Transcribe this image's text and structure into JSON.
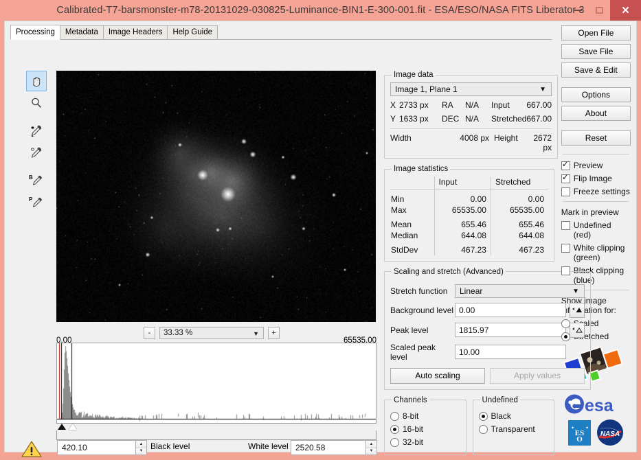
{
  "window": {
    "title": "Calibrated-T7-barsmonster-m78-20131029-030825-Luminance-BIN1-E-300-001.fit - ESA/ESO/NASA FITS Liberator 3",
    "minimize_label": "–",
    "maximize_label": "□",
    "close_label": "✕",
    "titlebar_color": "#f5a394",
    "close_color": "#c75050"
  },
  "tabs": [
    {
      "label": "Processing",
      "active": true
    },
    {
      "label": "Metadata",
      "active": false
    },
    {
      "label": "Image Headers",
      "active": false
    },
    {
      "label": "Help Guide",
      "active": false
    }
  ],
  "tools": [
    {
      "name": "hand-tool",
      "selected": true
    },
    {
      "name": "zoom-tool",
      "selected": false
    },
    {
      "name": "white-picker-tool",
      "selected": false
    },
    {
      "name": "black-picker-tool",
      "selected": false
    },
    {
      "name": "background-picker-tool",
      "selected": false,
      "letter": "B"
    },
    {
      "name": "peak-picker-tool",
      "selected": false,
      "letter": "P"
    }
  ],
  "zoom_bar": {
    "minus_label": "-",
    "plus_label": "+",
    "value": "33.33 %",
    "range_low": "0.00",
    "range_high": "65535.00"
  },
  "levels": {
    "black_value": "420.10",
    "black_label": "Black level",
    "white_label": "White level",
    "white_value": "2520.58",
    "warning_icon": "warning-triangle-icon"
  },
  "image_data": {
    "legend": "Image data",
    "plane_selector": "Image 1, Plane 1",
    "rows": [
      {
        "k": "X",
        "v1": "2733 px",
        "k2": "RA",
        "v2": "N/A",
        "k3": "Input",
        "v3": "667.00"
      },
      {
        "k": "Y",
        "v1": "1633 px",
        "k2": "DEC",
        "v2": "N/A",
        "k3": "Stretched",
        "v3": "667.00"
      }
    ],
    "width_label": "Width",
    "width_value": "4008 px",
    "height_label": "Height",
    "height_value": "2672 px"
  },
  "image_statistics": {
    "legend": "Image statistics",
    "col_input": "Input",
    "col_stretched": "Stretched",
    "rows": [
      {
        "label": "Min",
        "input": "0.00",
        "stretched": "0.00"
      },
      {
        "label": "Max",
        "input": "65535.00",
        "stretched": "65535.00"
      },
      {
        "label": "Mean",
        "input": "655.46",
        "stretched": "655.46"
      },
      {
        "label": "Median",
        "input": "644.08",
        "stretched": "644.08"
      },
      {
        "label": "StdDev",
        "input": "467.23",
        "stretched": "467.23"
      }
    ]
  },
  "scaling": {
    "legend": "Scaling and stretch (Advanced)",
    "stretch_label": "Stretch function",
    "stretch_value": "Linear",
    "background_label": "Background level",
    "background_value": "0.00",
    "peak_label": "Peak level",
    "peak_value": "1815.97",
    "scaled_peak_label": "Scaled peak level",
    "scaled_peak_value": "10.00",
    "auto_scaling_label": "Auto scaling",
    "apply_values_label": "Apply values"
  },
  "channels": {
    "legend": "Channels",
    "options": [
      {
        "label": "8-bit",
        "selected": false
      },
      {
        "label": "16-bit",
        "selected": true
      },
      {
        "label": "32-bit",
        "selected": false
      }
    ]
  },
  "undefined_group": {
    "legend": "Undefined",
    "options": [
      {
        "label": "Black",
        "selected": true
      },
      {
        "label": "Transparent",
        "selected": false
      }
    ]
  },
  "right_rail": {
    "buttons_top": [
      "Open File",
      "Save File",
      "Save & Edit"
    ],
    "buttons_mid": [
      "Options",
      "About"
    ],
    "buttons_bottom": [
      "Reset"
    ],
    "checkboxes": [
      {
        "label": "Preview",
        "checked": true
      },
      {
        "label": "Flip Image",
        "checked": true
      },
      {
        "label": "Freeze settings",
        "checked": false
      }
    ],
    "mark_label": "Mark in preview",
    "mark_checkboxes": [
      {
        "label": "Undefined (red)",
        "checked": false
      },
      {
        "label": "White clipping (green)",
        "checked": false
      },
      {
        "label": "Black clipping (blue)",
        "checked": false
      }
    ],
    "show_info_label": "Show image information for:",
    "show_info_options": [
      {
        "label": "Scaled",
        "selected": false
      },
      {
        "label": "Stretched",
        "selected": true
      }
    ],
    "logos": [
      "fits-liberator-logo",
      "esa-logo",
      "eso-logo",
      "nasa-logo"
    ]
  },
  "histogram": {
    "peak_position": 0.035,
    "red_marker": 0.005,
    "black_marker": 0.012,
    "white_marker": 0.038
  }
}
